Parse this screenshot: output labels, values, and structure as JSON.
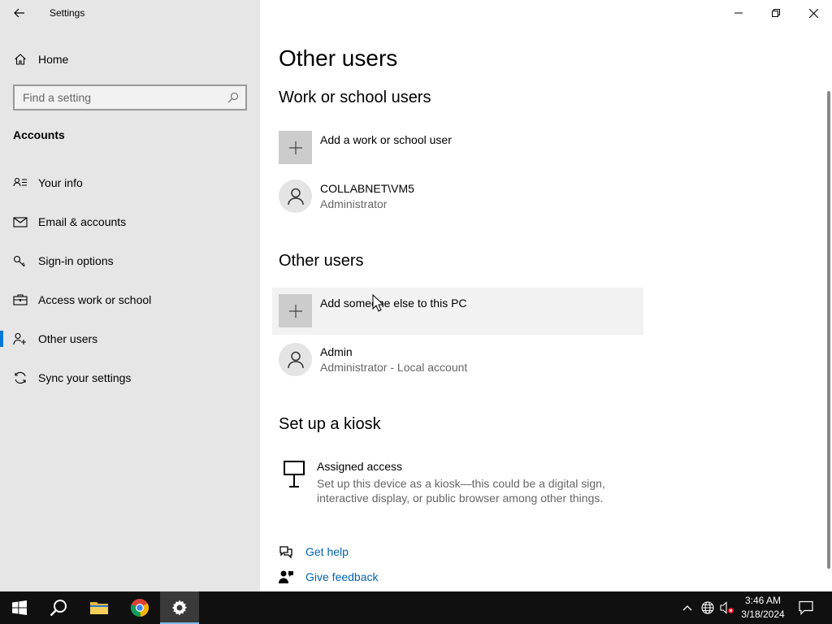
{
  "window": {
    "title": "Settings",
    "controls": {
      "minimize": "minimize",
      "restore": "restore",
      "close": "close"
    }
  },
  "sidebar": {
    "home_label": "Home",
    "search_placeholder": "Find a setting",
    "section_label": "Accounts",
    "items": [
      {
        "label": "Your info",
        "icon": "contact-card-icon",
        "active": false
      },
      {
        "label": "Email & accounts",
        "icon": "mail-icon",
        "active": false
      },
      {
        "label": "Sign-in options",
        "icon": "key-icon",
        "active": false
      },
      {
        "label": "Access work or school",
        "icon": "briefcase-icon",
        "active": false
      },
      {
        "label": "Other users",
        "icon": "add-person-icon",
        "active": true
      },
      {
        "label": "Sync your settings",
        "icon": "sync-icon",
        "active": false
      }
    ]
  },
  "main": {
    "page_title": "Other users",
    "work_section": {
      "heading": "Work or school users",
      "add_label": "Add a work or school user",
      "users": [
        {
          "name": "COLLABNET\\VM5",
          "role": "Administrator"
        }
      ]
    },
    "other_section": {
      "heading": "Other users",
      "add_label": "Add someone else to this PC",
      "users": [
        {
          "name": "Admin",
          "role": "Administrator - Local account"
        }
      ]
    },
    "kiosk_section": {
      "heading": "Set up a kiosk",
      "title": "Assigned access",
      "description": "Set up this device as a kiosk—this could be a digital sign, interactive display, or public browser among other things."
    },
    "links": {
      "get_help": "Get help",
      "give_feedback": "Give feedback"
    }
  },
  "taskbar": {
    "apps": [
      "start-icon",
      "search-icon",
      "file-explorer-icon",
      "chrome-icon",
      "settings-icon"
    ],
    "active_app": "settings-icon",
    "clock_time": "3:46 AM",
    "clock_date": "3/18/2024"
  },
  "colors": {
    "accent": "#0078d7",
    "link": "#0063b1",
    "sidebar_bg": "#e6e6e6",
    "taskbar_bg": "#101010"
  }
}
